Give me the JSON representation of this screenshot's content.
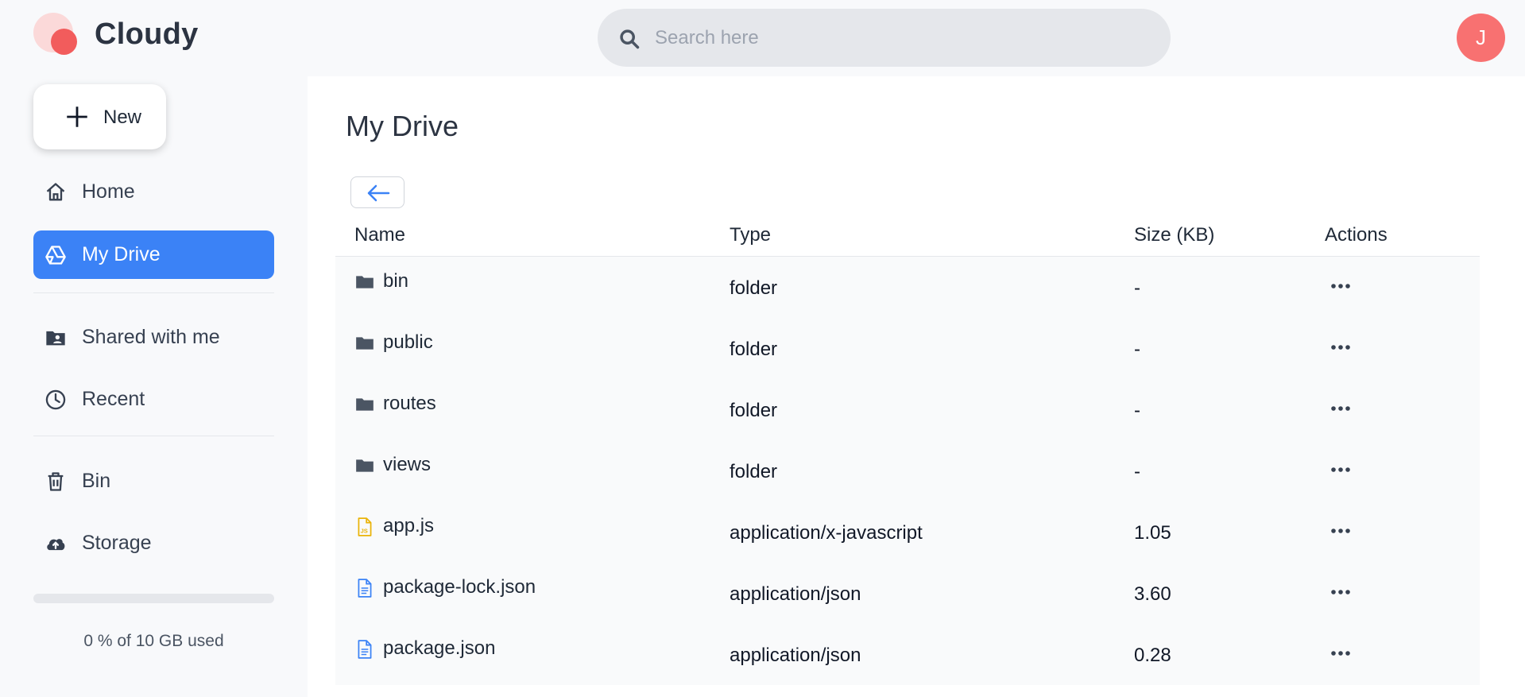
{
  "app": {
    "name": "Cloudy",
    "avatar_initial": "J"
  },
  "search": {
    "placeholder": "Search here",
    "value": ""
  },
  "sidebar": {
    "new_label": "New",
    "items": [
      {
        "label": "Home",
        "icon": "home-icon",
        "active": false
      },
      {
        "label": "My Drive",
        "icon": "drive-icon",
        "active": true
      },
      {
        "label": "Shared with me",
        "icon": "shared-folder-icon",
        "active": false
      },
      {
        "label": "Recent",
        "icon": "clock-icon",
        "active": false
      },
      {
        "label": "Bin",
        "icon": "trash-icon",
        "active": false
      },
      {
        "label": "Storage",
        "icon": "cloud-upload-icon",
        "active": false
      }
    ],
    "storage": {
      "used_percent": 0,
      "text": "0 % of 10 GB used"
    }
  },
  "main": {
    "title": "My Drive",
    "columns": [
      "Name",
      "Type",
      "Size (KB)",
      "Actions"
    ],
    "rows": [
      {
        "name": "bin",
        "type": "folder",
        "size": "-",
        "icon": "folder-icon"
      },
      {
        "name": "public",
        "type": "folder",
        "size": "-",
        "icon": "folder-icon"
      },
      {
        "name": "routes",
        "type": "folder",
        "size": "-",
        "icon": "folder-icon"
      },
      {
        "name": "views",
        "type": "folder",
        "size": "-",
        "icon": "folder-icon"
      },
      {
        "name": "app.js",
        "type": "application/x-javascript",
        "size": "1.05",
        "icon": "js-file-icon"
      },
      {
        "name": "package-lock.json",
        "type": "application/json",
        "size": "3.60",
        "icon": "document-icon"
      },
      {
        "name": "package.json",
        "type": "application/json",
        "size": "0.28",
        "icon": "document-icon"
      }
    ]
  },
  "colors": {
    "accent": "#3b82f6",
    "avatar": "#f87171",
    "brand_logo": "#f25c5c"
  }
}
